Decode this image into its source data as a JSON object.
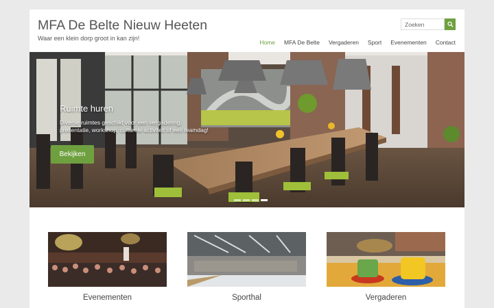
{
  "site": {
    "title": "MFA De Belte Nieuw Heeten",
    "tagline": "Waar een klein dorp groot in kan zijn!"
  },
  "search": {
    "placeholder": "Zoeken",
    "icon": "search-icon"
  },
  "nav": {
    "items": [
      {
        "label": "Home",
        "active": true
      },
      {
        "label": "MFA De Belte",
        "active": false
      },
      {
        "label": "Vergaderen",
        "active": false
      },
      {
        "label": "Sport",
        "active": false
      },
      {
        "label": "Evenementen",
        "active": false
      },
      {
        "label": "Contact",
        "active": false
      }
    ]
  },
  "slider": {
    "title": "Ruimte huren",
    "text": "Diverse ruimtes geschikt voor een vergadering, presentatie, workshop, culturele activiteit of een teamdag!",
    "button": "Bekijken",
    "slide_count": 4,
    "active_slide": 4
  },
  "features": [
    {
      "title": "Evenementen"
    },
    {
      "title": "Sporthal"
    },
    {
      "title": "Vergaderen"
    }
  ],
  "colors": {
    "accent": "#6fa03f",
    "background": "#eaeaea",
    "text": "#555555"
  }
}
